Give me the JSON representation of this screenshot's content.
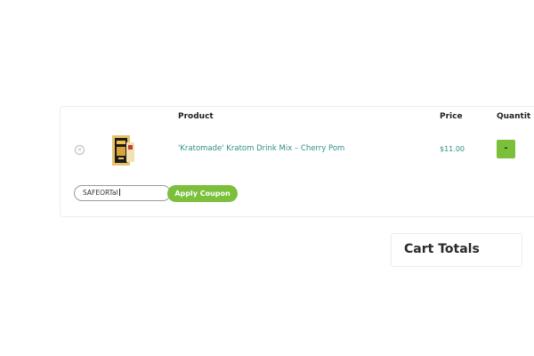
{
  "cart": {
    "headers": {
      "product": "Product",
      "price": "Price",
      "quantity": "Quantit"
    },
    "items": [
      {
        "remove_icon": "remove-circle-icon",
        "name": "'Kratomade' Kratom Drink Mix – Cherry Pom",
        "price": "$11.00",
        "qty_control": "-"
      }
    ],
    "coupon": {
      "value": "SAFEORTal",
      "apply_label": "Apply Coupon"
    }
  },
  "totals": {
    "title": "Cart Totals"
  },
  "colors": {
    "accent_green": "#7bbf3b",
    "link_teal": "#2f8f86",
    "border": "#ececec"
  }
}
